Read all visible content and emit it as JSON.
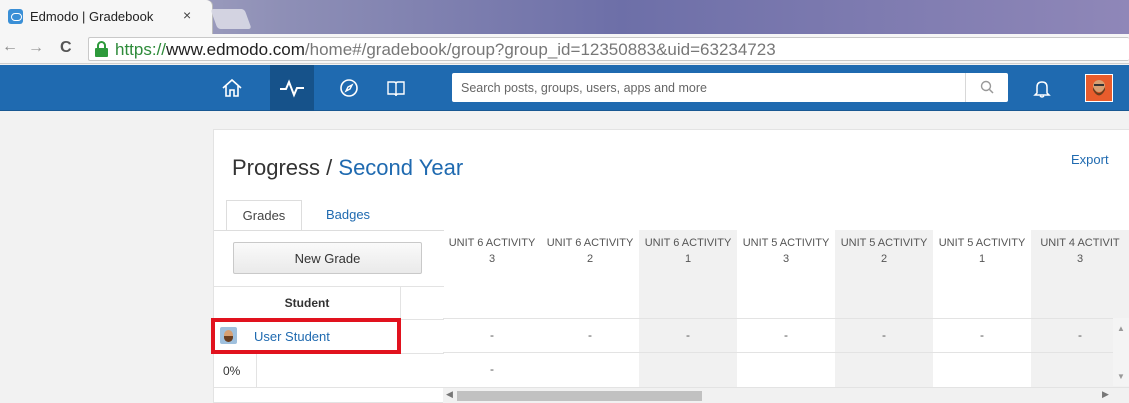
{
  "browser": {
    "tab_title": "Edmodo | Gradebook",
    "tab_close": "×",
    "url_scheme": "https://",
    "url_host": "www.edmodo.com",
    "url_path": "/home#/gradebook/group?group_id=12350883&uid=63234723",
    "back_glyph": "←",
    "forward_glyph": "→",
    "reload_glyph": "C"
  },
  "topnav": {
    "icons": [
      "home-icon",
      "activity-icon",
      "discover-icon",
      "library-icon",
      "bell-icon"
    ],
    "search_placeholder": "Search posts, groups, users, apps and more"
  },
  "page": {
    "title_prefix": "Progress",
    "title_sep": " / ",
    "group_name": "Second Year",
    "export_label": "Export",
    "tabs": [
      {
        "label": "Grades",
        "active": true
      },
      {
        "label": "Badges",
        "active": false
      }
    ],
    "new_grade_label": "New Grade",
    "student_header": "Student",
    "student_name": "User Student",
    "student_percent": "0%"
  },
  "grid": {
    "columns": [
      {
        "title": "UNIT 6 ACTIVITY",
        "number": "3",
        "shade": false,
        "value": "-",
        "bottom": "-"
      },
      {
        "title": "UNIT 6 ACTIVITY",
        "number": "2",
        "shade": false,
        "value": "-",
        "bottom": ""
      },
      {
        "title": "UNIT 6 ACTIVITY",
        "number": "1",
        "shade": true,
        "value": "-",
        "bottom": ""
      },
      {
        "title": "UNIT 5 ACTIVITY",
        "number": "3",
        "shade": false,
        "value": "-",
        "bottom": ""
      },
      {
        "title": "UNIT 5 ACTIVITY",
        "number": "2",
        "shade": true,
        "value": "-",
        "bottom": ""
      },
      {
        "title": "UNIT 5 ACTIVITY",
        "number": "1",
        "shade": false,
        "value": "-",
        "bottom": ""
      },
      {
        "title": "UNIT 4 ACTIVIT",
        "number": "3",
        "shade": true,
        "value": "-",
        "bottom": ""
      }
    ]
  },
  "colors": {
    "nav_blue": "#1f6ab0",
    "highlight_red": "#e1121e"
  }
}
